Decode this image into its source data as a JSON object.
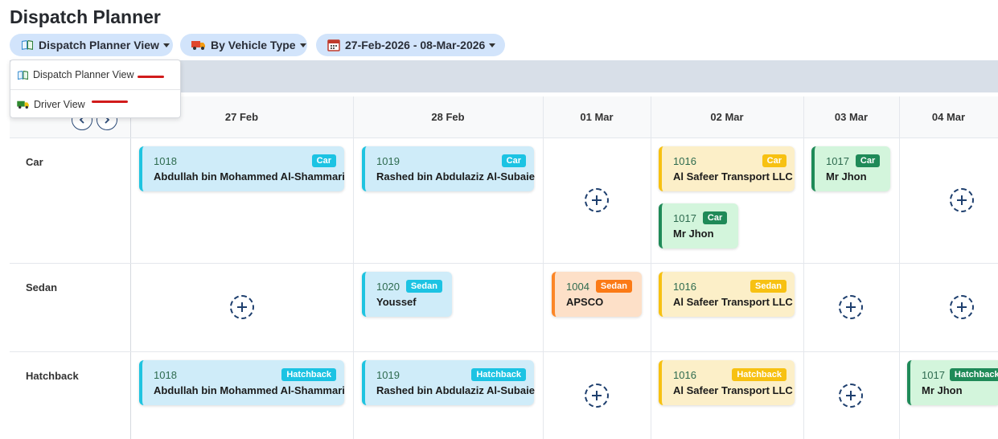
{
  "page_title": "Dispatch Planner",
  "toolbar": {
    "view_label": "Dispatch Planner View",
    "group_label": "By Vehicle Type",
    "date_range_label": "27-Feb-2026 - 08-Mar-2026"
  },
  "dropdown": {
    "items": [
      {
        "label": "Dispatch Planner View",
        "icon": "book-icon"
      },
      {
        "label": "Driver View",
        "icon": "truck-icon"
      }
    ]
  },
  "dates": [
    "27 Feb",
    "28 Feb",
    "01 Mar",
    "02 Mar",
    "03 Mar",
    "04 Mar"
  ],
  "rows": [
    "Car",
    "Sedan",
    "Hatchback"
  ],
  "cards": [
    {
      "id": "1018",
      "badge": "Car",
      "name": "Abdullah bin Mohammed Al-Shammari",
      "color": "blue"
    },
    {
      "id": "1019",
      "badge": "Car",
      "name": "Rashed bin Abdulaziz Al-Subaie",
      "color": "blue"
    },
    {
      "id": "1016",
      "badge": "Car",
      "name": "Al Safeer Transport LLC",
      "color": "yellow"
    },
    {
      "id": "1017",
      "badge": "Car",
      "name": "Mr Jhon",
      "color": "green"
    },
    {
      "id": "1017",
      "badge": "Car",
      "name": "Mr Jhon",
      "color": "green"
    },
    {
      "id": "1020",
      "badge": "Sedan",
      "name": "Youssef",
      "color": "blue"
    },
    {
      "id": "1004",
      "badge": "Sedan",
      "name": "APSCO",
      "color": "orange"
    },
    {
      "id": "1016",
      "badge": "Sedan",
      "name": "Al Safeer Transport LLC",
      "color": "yellow"
    },
    {
      "id": "1018",
      "badge": "Hatchback",
      "name": "Abdullah bin Mohammed Al-Shammari",
      "color": "blue"
    },
    {
      "id": "1019",
      "badge": "Hatchback",
      "name": "Rashed bin Abdulaziz Al-Subaie",
      "color": "blue"
    },
    {
      "id": "1016",
      "badge": "Hatchback",
      "name": "Al Safeer Transport LLC",
      "color": "yellow"
    },
    {
      "id": "1017",
      "badge": "Hatchback",
      "name": "Mr Jhon",
      "color": "green"
    }
  ],
  "colors": {
    "blue": "#1fc4e0",
    "yellow": "#f7c112",
    "green": "#1f8a58",
    "orange": "#fb8627",
    "add_button": "#1e3f6e",
    "highlight_mark": "#d11b1b"
  }
}
